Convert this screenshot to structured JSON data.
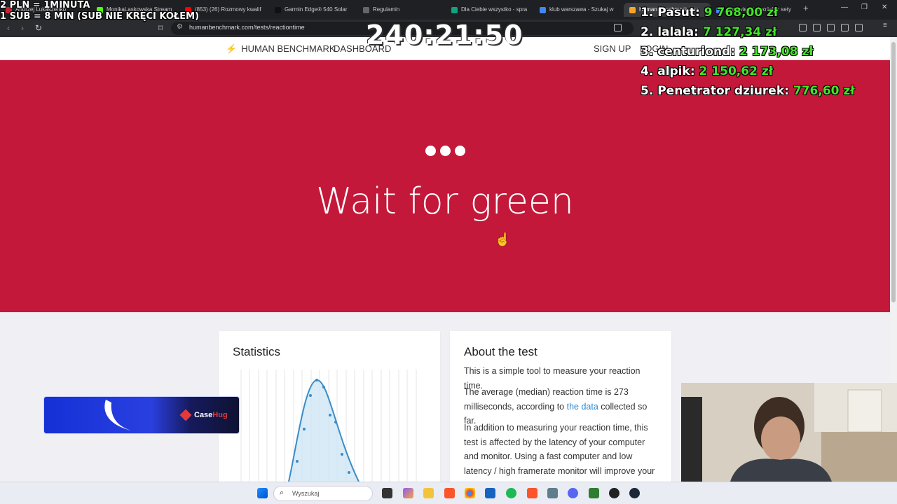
{
  "browser": {
    "tabs": [
      {
        "label": "Andrzej Lukaszenko",
        "color": "#cc2233"
      },
      {
        "label": "MonikaLaskowska Stream",
        "color": "#53fc18"
      },
      {
        "label": "(853) (26) Rozmowy kwalif",
        "color": "#ff0000"
      },
      {
        "label": "Garmin Edge® 540 Solar",
        "color": "#111111"
      },
      {
        "label": "Regulamin",
        "color": "#666666"
      },
      {
        "label": "Dla Ciebie wszystko - spra",
        "color": "#10a37f"
      },
      {
        "label": "klub warszawa - Szukaj w",
        "color": "#4285f4"
      },
      {
        "label": "Human Benchmark",
        "color": "#f5a623"
      },
      {
        "label": "odpowiedzi japońskie sety",
        "color": "#4285f4"
      }
    ],
    "new_tab_icon": "plus-icon",
    "url": "humanbenchmark.com/tests/reactiontime"
  },
  "site": {
    "brand": "HUMAN BENCHMARK",
    "dashboard": "DASHBOARD",
    "signup": "SIGN UP",
    "login": "LOGIN"
  },
  "test": {
    "heading": "Wait for green",
    "background": "#c3183a"
  },
  "statistics": {
    "title": "Statistics"
  },
  "about": {
    "title": "About the test",
    "p1": "This is a simple tool to measure your reaction time.",
    "p2_before": "The average (median) reaction time is 273 milliseconds, according to ",
    "p2_link": "the data",
    "p2_after": " collected so far.",
    "p3": "In addition to measuring your reaction time, this test is affected by the latency of your computer and monitor. Using a fast computer and low latency / high framerate monitor will improve your score."
  },
  "taskbar": {
    "search_placeholder": "Wyszukaj"
  },
  "overlay": {
    "promo_line1": "2 PLN = 1MINUTA",
    "promo_line2": "1 SUB = 8 MIN (SUB NIE KRĘCI KOŁEM)",
    "timer": "240:21:50",
    "leaderboard": [
      {
        "rank": "1.",
        "name": "Pasut:",
        "amount": "9 768,00 zł"
      },
      {
        "rank": "2.",
        "name": "lalala:",
        "amount": "7 127,34 zł"
      },
      {
        "rank": "3.",
        "name": "centuriond:",
        "amount": "2 173,08 zł"
      },
      {
        "rank": "4.",
        "name": "alpik:",
        "amount": "2 150,62 zł"
      },
      {
        "rank": "5.",
        "name": "Penetrator dziurek:",
        "amount": "776,60 zł"
      }
    ],
    "sponsor_a": "Case",
    "sponsor_b": "Hug"
  }
}
